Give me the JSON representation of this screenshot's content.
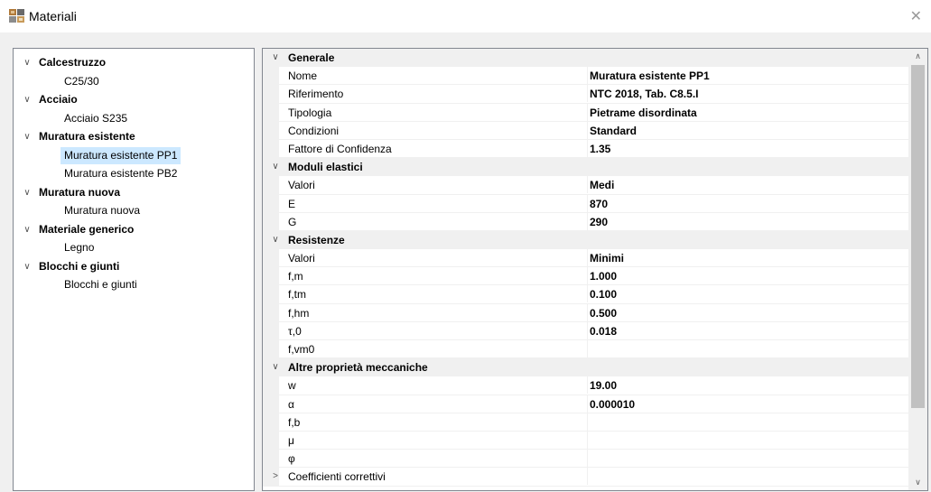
{
  "window": {
    "title": "Materiali",
    "icon": "materials-app-icon",
    "close_glyph": "✕"
  },
  "tree": {
    "groups": [
      {
        "label": "Calcestruzzo",
        "chevron": "∨",
        "items": [
          "C25/30"
        ]
      },
      {
        "label": "Acciaio",
        "chevron": "∨",
        "items": [
          "Acciaio S235"
        ]
      },
      {
        "label": "Muratura esistente",
        "chevron": "∨",
        "items": [
          "Muratura esistente PP1",
          "Muratura esistente PB2"
        ]
      },
      {
        "label": "Muratura nuova",
        "chevron": "∨",
        "items": [
          "Muratura nuova"
        ]
      },
      {
        "label": "Materiale generico",
        "chevron": "∨",
        "items": [
          "Legno"
        ]
      },
      {
        "label": "Blocchi e giunti",
        "chevron": "∨",
        "items": [
          "Blocchi e giunti"
        ]
      }
    ],
    "selected": "Muratura esistente PP1"
  },
  "grid": {
    "categories": [
      {
        "label": "Generale",
        "chevron": "∨",
        "rows": [
          {
            "label": "Nome",
            "value": "Muratura esistente PP1"
          },
          {
            "label": "Riferimento",
            "value": "NTC 2018, Tab. C8.5.I"
          },
          {
            "label": "Tipologia",
            "value": "Pietrame disordinata"
          },
          {
            "label": "Condizioni",
            "value": "Standard"
          },
          {
            "label": "Fattore di Confidenza",
            "value": "1.35"
          }
        ]
      },
      {
        "label": "Moduli elastici",
        "chevron": "∨",
        "rows": [
          {
            "label": "Valori",
            "value": "Medi"
          },
          {
            "label": "E",
            "value": "870"
          },
          {
            "label": "G",
            "value": "290"
          }
        ]
      },
      {
        "label": "Resistenze",
        "chevron": "∨",
        "rows": [
          {
            "label": "Valori",
            "value": "Minimi"
          },
          {
            "label": "f,m",
            "value": "1.000"
          },
          {
            "label": "f,tm",
            "value": "0.100"
          },
          {
            "label": "f,hm",
            "value": "0.500"
          },
          {
            "label": "τ,0",
            "value": "0.018"
          },
          {
            "label": "f,vm0",
            "value": ""
          }
        ]
      },
      {
        "label": "Altre proprietà meccaniche",
        "chevron": "∨",
        "rows": [
          {
            "label": "w",
            "value": "19.00"
          },
          {
            "label": "α",
            "value": "0.000010"
          },
          {
            "label": "f,b",
            "value": ""
          },
          {
            "label": "μ",
            "value": ""
          },
          {
            "label": "φ",
            "value": ""
          }
        ]
      }
    ],
    "collapsed_category": {
      "label": "Coefficienti correttivi",
      "chevron": ">"
    }
  },
  "scrollbar": {
    "up_glyph": "∧",
    "down_glyph": "∨"
  }
}
